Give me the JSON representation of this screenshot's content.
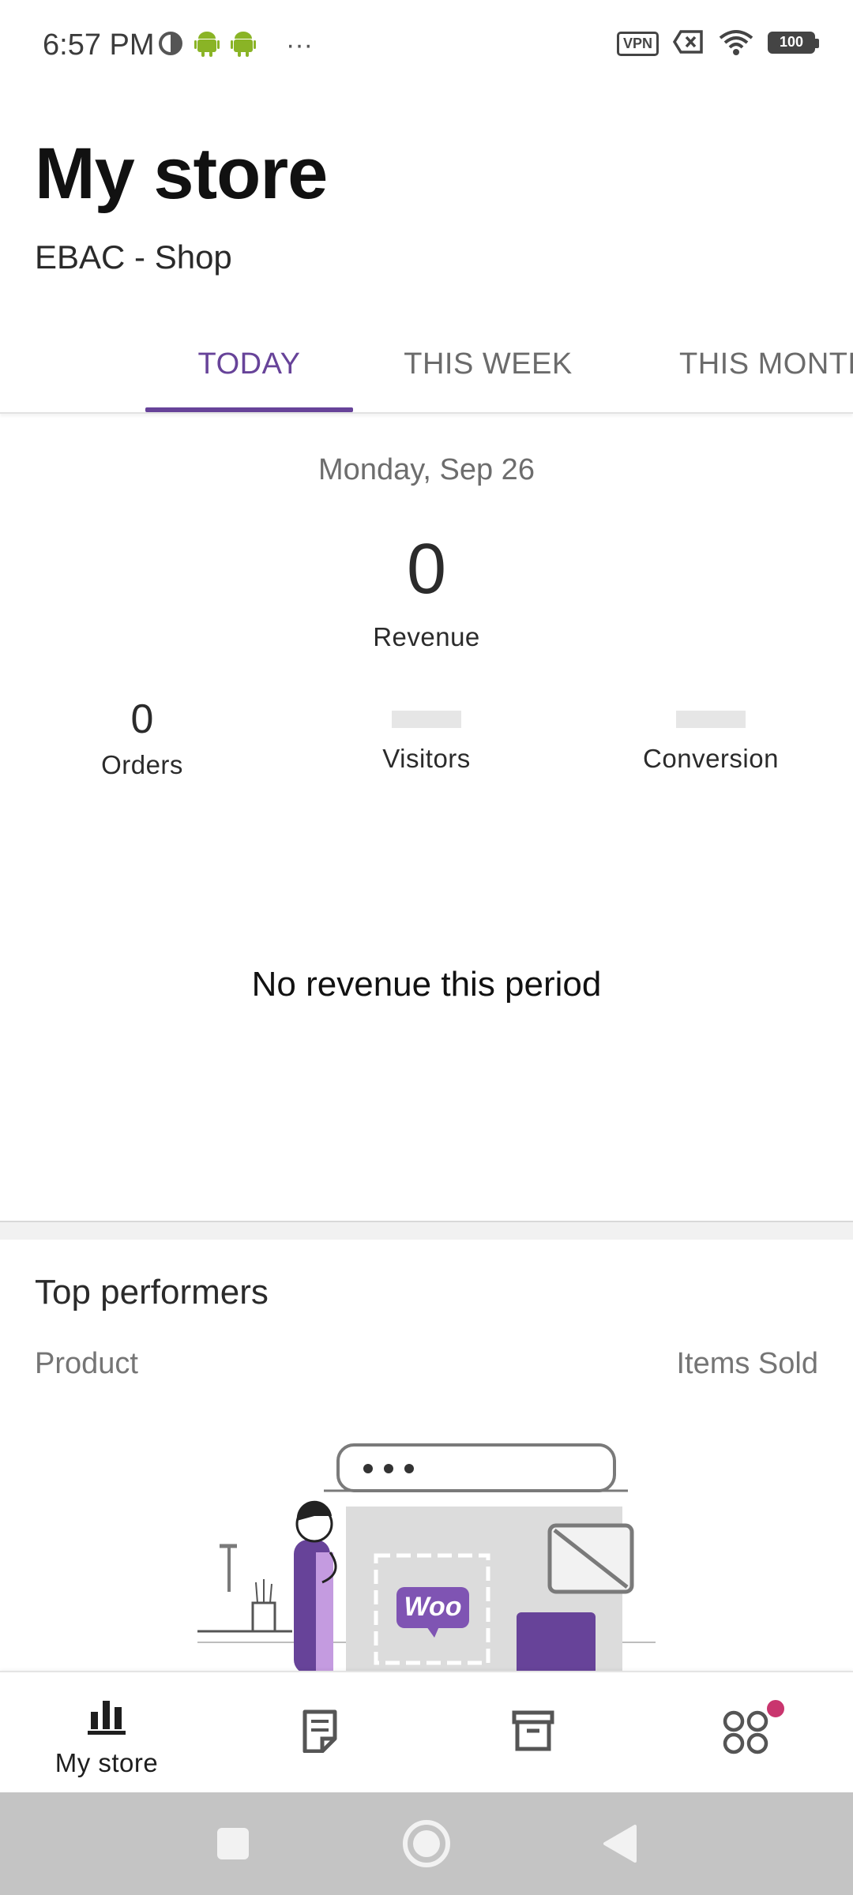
{
  "status_bar": {
    "time": "6:57 PM",
    "more": "···",
    "vpn": "VPN",
    "battery": "100"
  },
  "header": {
    "title": "My store",
    "store_name": "EBAC - Shop"
  },
  "tabs": [
    {
      "label": "TODAY",
      "active": true
    },
    {
      "label": "THIS WEEK",
      "active": false
    },
    {
      "label": "THIS MONTH",
      "active": false
    }
  ],
  "stats": {
    "date": "Monday, Sep 26",
    "revenue_value": "0",
    "revenue_label": "Revenue",
    "orders_value": "0",
    "orders_label": "Orders",
    "visitors_label": "Visitors",
    "conversion_label": "Conversion",
    "empty_message": "No revenue this period"
  },
  "top_performers": {
    "title": "Top performers",
    "col_product": "Product",
    "col_items_sold": "Items Sold",
    "illustration_logo": "Woo"
  },
  "bottom_nav": [
    {
      "label": "My store",
      "icon": "bar-chart-icon"
    },
    {
      "label": "",
      "icon": "orders-icon"
    },
    {
      "label": "",
      "icon": "products-icon"
    },
    {
      "label": "",
      "icon": "more-menu-icon"
    }
  ],
  "colors": {
    "accent": "#674399",
    "notification_dot": "#c9356e",
    "system_nav_bg": "#c4c4c4"
  }
}
